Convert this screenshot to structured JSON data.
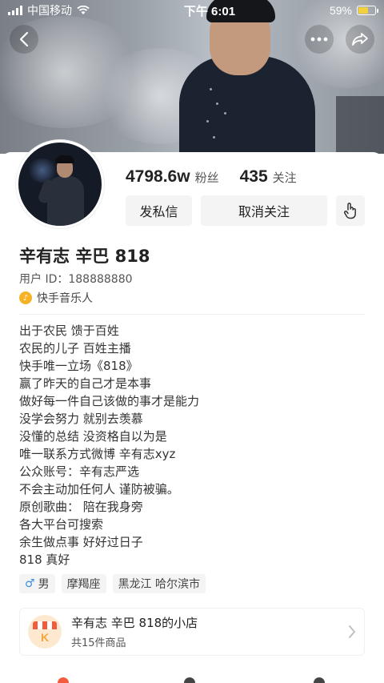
{
  "status_bar": {
    "carrier": "中国移动",
    "time": "下午 6:01",
    "battery_percent": "59%",
    "battery_level": 0.59
  },
  "header": {
    "back_icon": "chevron-left-icon",
    "more_icon": "more-icon",
    "share_icon": "share-icon"
  },
  "profile": {
    "followers_count": "4798.6w",
    "followers_label": "粉丝",
    "following_count": "435",
    "following_label": "关注",
    "message_button": "发私信",
    "unfollow_button": "取消关注",
    "name": "辛有志 辛巴 818",
    "user_id": "用户 ID：188888880",
    "badge": "快手音乐人"
  },
  "bio": [
    "出于农民 馈于百姓",
    "农民的儿子 百姓主播",
    "快手唯一立场《818》",
    "赢了昨天的自己才是本事",
    "做好每一件自己该做的事才是能力",
    "没学会努力 就别去羡慕",
    "没懂的总结 没资格自以为是",
    "唯一联系方式微博  辛有志xyz",
    "公众账号：辛有志严选",
    "不会主动加任何人 谨防被骗。",
    "原创歌曲： 陪在我身旁",
    "各大平台可搜索",
    "余生做点事 好好过日子",
    "818 真好"
  ],
  "tags": {
    "gender": "男",
    "zodiac": "摩羯座",
    "location": "黑龙江 哈尔滨市"
  },
  "shop": {
    "name": "辛有志 辛巴 818的小店",
    "count": "共15件商品",
    "logo_letter": "K"
  },
  "colors": {
    "accent_gender": "#3d8fe0",
    "badge_gold": "#f7b125",
    "battery": "#f4d03f"
  }
}
